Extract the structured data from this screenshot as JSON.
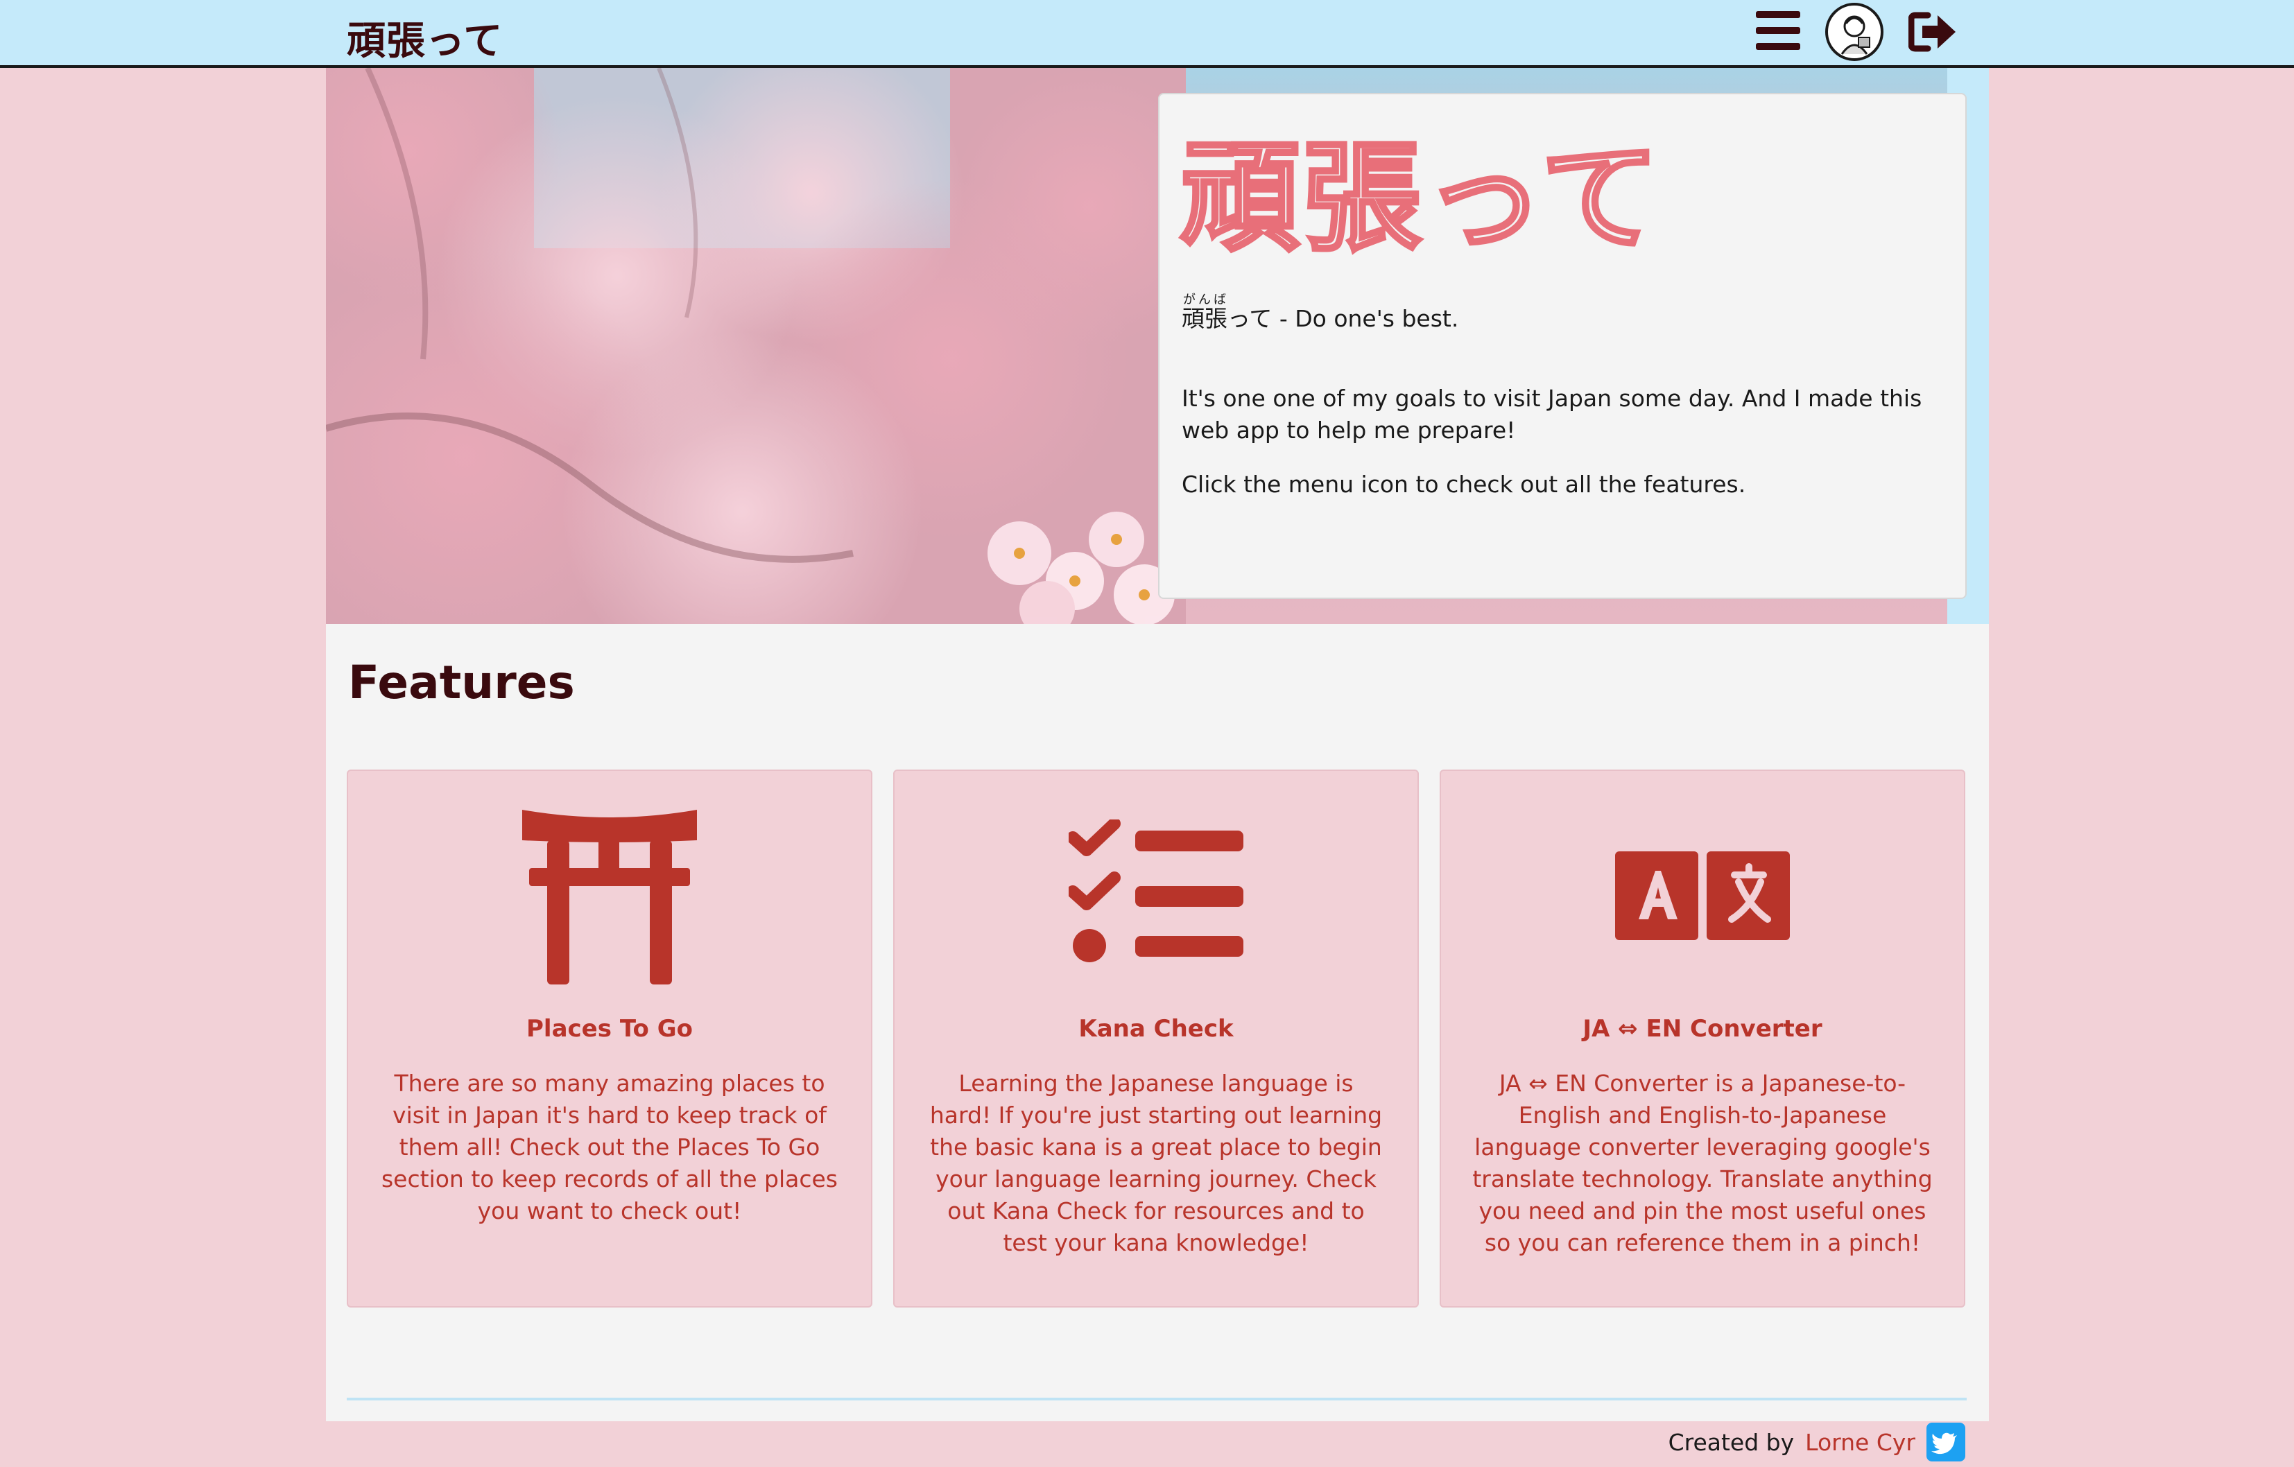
{
  "header": {
    "brand": "頑張って"
  },
  "hero": {
    "title": "頑張って",
    "meaning_base": "頑張",
    "meaning_ruby": "がんば",
    "meaning_rest": "って - Do one's best.",
    "goal_text": "It's one one of my goals to visit Japan some day. And I made this web app to help me prepare!",
    "menu_hint": "Click the menu icon to check out all the features."
  },
  "features": {
    "heading": "Features",
    "cards": [
      {
        "icon": "torii-gate-icon",
        "title": "Places To Go",
        "description": "There are so many amazing places to visit in Japan it's hard to keep track of them all! Check out the Places To Go section to keep records of all the places you want to check out!"
      },
      {
        "icon": "checklist-icon",
        "title": "Kana Check",
        "description": "Learning the Japanese language is hard! If you're just starting out learning the basic kana is a great place to begin your language learning journey. Check out Kana Check for resources and to test your kana knowledge!"
      },
      {
        "icon": "translate-icon",
        "title": "JA ⇔ EN Converter",
        "description": "JA ⇔ EN Converter is a Japanese-to-English and English-to-Japanese language converter leveraging google's translate technology. Translate anything you need and pin the most useful ones so you can reference them in a pinch!"
      }
    ]
  },
  "footer": {
    "created_by": "Created by",
    "author": "Lorne Cyr"
  },
  "colors": {
    "topbar": "#c5eafa",
    "page_background": "#f2d1d7",
    "accent_red": "#b8342a",
    "title_outline": "#e86f79",
    "dark_text": "#3a0a0e"
  }
}
